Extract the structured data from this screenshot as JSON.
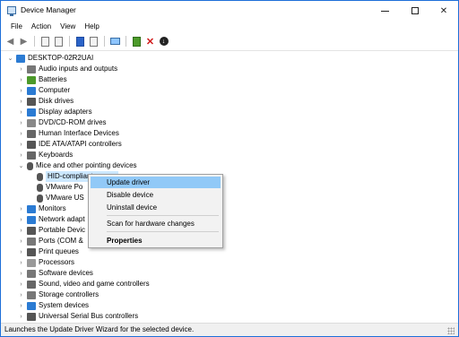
{
  "window": {
    "title": "Device Manager"
  },
  "menu": [
    "File",
    "Action",
    "View",
    "Help"
  ],
  "toolbar": {
    "icons": [
      "back-arrow-icon",
      "forward-arrow-icon",
      "properties-icon",
      "properties-icon",
      "help-icon",
      "properties-icon",
      "monitor-icon",
      "enable-device-icon",
      "uninstall-x-icon",
      "download-icon"
    ]
  },
  "tree": {
    "root": "DESKTOP-02R2UAI",
    "categories": [
      {
        "label": "Audio inputs and outputs",
        "icon_color": "#777777"
      },
      {
        "label": "Batteries",
        "icon_color": "#4c9a2a"
      },
      {
        "label": "Computer",
        "icon_color": "#2b7bd3"
      },
      {
        "label": "Disk drives",
        "icon_color": "#555555"
      },
      {
        "label": "Display adapters",
        "icon_color": "#2b7bd3"
      },
      {
        "label": "DVD/CD-ROM drives",
        "icon_color": "#888888"
      },
      {
        "label": "Human Interface Devices",
        "icon_color": "#666666"
      },
      {
        "label": "IDE ATA/ATAPI controllers",
        "icon_color": "#555555"
      },
      {
        "label": "Keyboards",
        "icon_color": "#666666"
      },
      {
        "label": "Mice and other pointing devices",
        "icon_color": "#555555"
      }
    ],
    "mice_children": [
      "HID-compliant mouse",
      "VMware Po",
      "VMware US"
    ],
    "categories_after": [
      {
        "label": "Monitors",
        "icon_color": "#2b7bd3"
      },
      {
        "label": "Network adapt",
        "icon_color": "#2b7bd3"
      },
      {
        "label": "Portable Devic",
        "icon_color": "#555555"
      },
      {
        "label": "Ports (COM &",
        "icon_color": "#777777"
      },
      {
        "label": "Print queues",
        "icon_color": "#555555"
      },
      {
        "label": "Processors",
        "icon_color": "#999999"
      },
      {
        "label": "Software devices",
        "icon_color": "#777777"
      },
      {
        "label": "Sound, video and game controllers",
        "icon_color": "#666666"
      },
      {
        "label": "Storage controllers",
        "icon_color": "#777777"
      },
      {
        "label": "System devices",
        "icon_color": "#2b7bd3"
      },
      {
        "label": "Universal Serial Bus controllers",
        "icon_color": "#555555"
      }
    ]
  },
  "context_menu": {
    "items": [
      "Update driver",
      "Disable device",
      "Uninstall device",
      "Scan for hardware changes",
      "Properties"
    ]
  },
  "status": {
    "text": "Launches the Update Driver Wizard for the selected device."
  },
  "colors": {
    "selection": "#cce8ff",
    "menu_highlight": "#91c9f7",
    "accent": "#1e6fd9"
  }
}
